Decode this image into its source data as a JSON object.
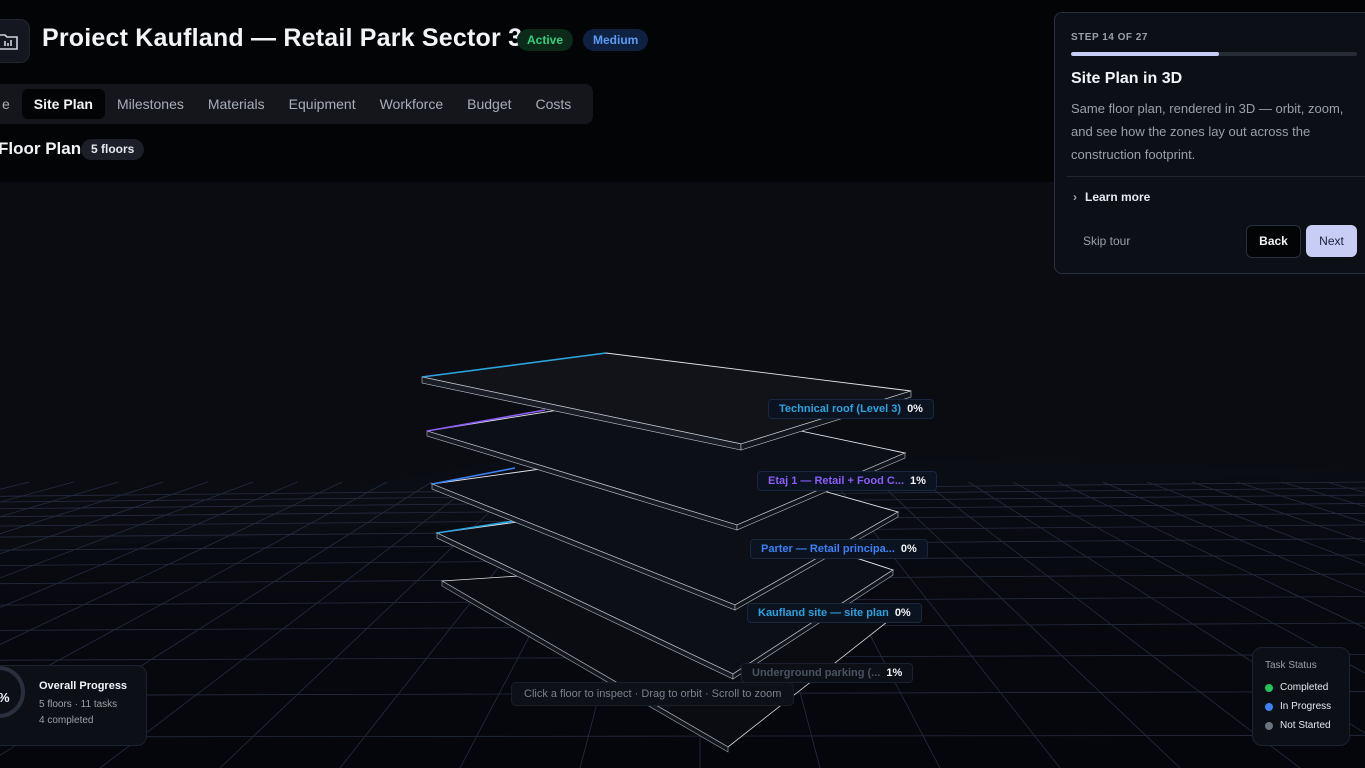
{
  "project": {
    "title": "Proiect Kaufland — Retail Park Sector 3",
    "status_badge": "Active",
    "priority_badge": "Medium",
    "icon": "folder-chart-icon"
  },
  "tabs": [
    {
      "label": "e",
      "active": false
    },
    {
      "label": "Site Plan",
      "active": true
    },
    {
      "label": "Milestones",
      "active": false
    },
    {
      "label": "Materials",
      "active": false
    },
    {
      "label": "Equipment",
      "active": false
    },
    {
      "label": "Workforce",
      "active": false
    },
    {
      "label": "Budget",
      "active": false
    },
    {
      "label": "Costs",
      "active": false
    }
  ],
  "floor_plan": {
    "title": "Floor Plan",
    "count_badge": "5 floors"
  },
  "floors": [
    {
      "name": "Technical roof (Level 3)",
      "pct": "0%",
      "color": "#2ba3dc"
    },
    {
      "name": "Etaj 1 — Retail + Food C...",
      "pct": "1%",
      "color": "#8b5cf6"
    },
    {
      "name": "Parter — Retail principa...",
      "pct": "0%",
      "color": "#3b82f6"
    },
    {
      "name": "Kaufland site — site plan",
      "pct": "0%",
      "color": "#2ba3dc"
    },
    {
      "name": "Underground parking (...",
      "pct": "1%",
      "color": "#4b5263"
    }
  ],
  "hint": "Click a floor to inspect · Drag to orbit · Scroll to zoom",
  "overall_progress": {
    "title": "Overall Progress",
    "percent_text": "%",
    "floors_tasks": "5 floors · 11 tasks",
    "completed": "4 completed"
  },
  "task_status": {
    "title": "Task Status",
    "items": [
      {
        "label": "Completed",
        "color": "#22c55e"
      },
      {
        "label": "In Progress",
        "color": "#3b82f6"
      },
      {
        "label": "Not Started",
        "color": "#6b7280"
      }
    ]
  },
  "tour": {
    "step": "STEP 14 OF 27",
    "progress": 0.5185,
    "title": "Site Plan in 3D",
    "body": "Same floor plan, rendered in 3D — orbit, zoom, and see how the zones lay out across the construction footprint.",
    "learn_more": "Learn more",
    "skip": "Skip tour",
    "back": "Back",
    "next": "Next"
  }
}
